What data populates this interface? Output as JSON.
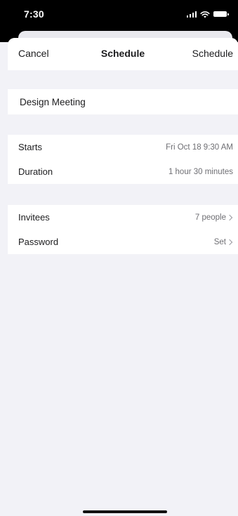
{
  "status_bar": {
    "time": "7:30",
    "icons": [
      "signal-icon",
      "wifi-icon",
      "battery-icon"
    ]
  },
  "nav": {
    "cancel_label": "Cancel",
    "title": "Schedule",
    "action_label": "Schedule"
  },
  "meeting": {
    "topic": "Design Meeting"
  },
  "time_group": {
    "starts_label": "Starts",
    "starts_value": "Fri Oct 18 9:30 AM",
    "duration_label": "Duration",
    "duration_value": "1 hour 30 minutes"
  },
  "options_group": {
    "invitees_label": "Invitees",
    "invitees_value": "7 people",
    "password_label": "Password",
    "password_value": "Set"
  },
  "colors": {
    "background": "#f2f2f7",
    "surface": "#ffffff",
    "text": "#1c1c1e",
    "secondary_text": "#6e6e73"
  }
}
